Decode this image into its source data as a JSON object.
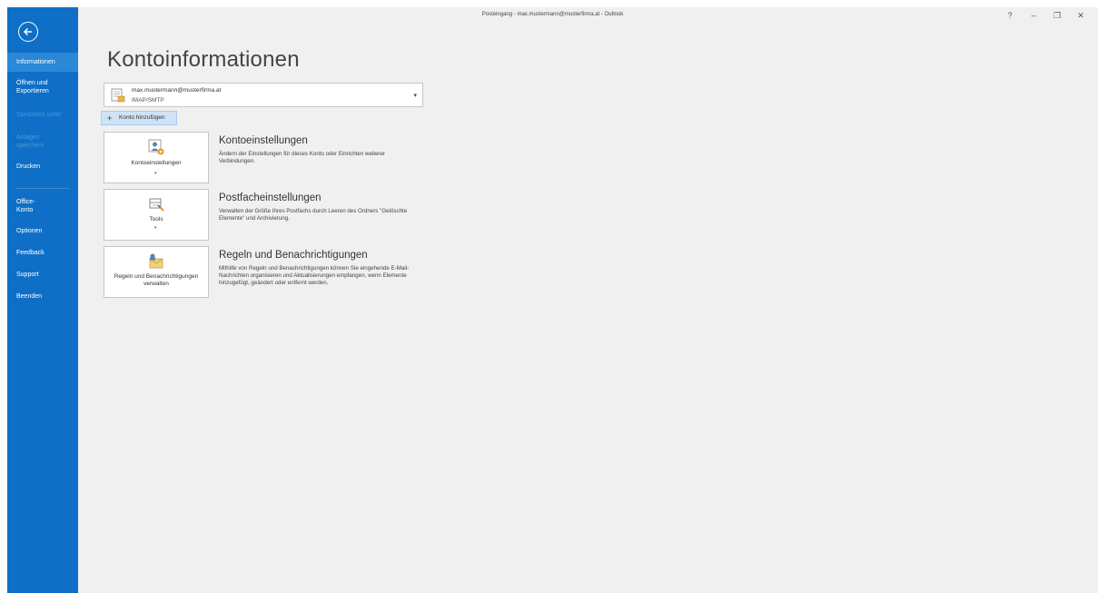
{
  "window": {
    "title": "Posteingang - max.mustermann@musterfirma.at - Outlook",
    "help_label": "?",
    "minimize_label": "–",
    "restore_label": "❐",
    "close_label": "✕"
  },
  "sidebar": {
    "items": [
      {
        "label": "Informationen",
        "state": "active"
      },
      {
        "label": "Öffnen und Exportieren",
        "state": "normal"
      },
      {
        "label": "Speichern unter",
        "state": "disabled"
      },
      {
        "label": "Anlagen speichern",
        "state": "disabled"
      },
      {
        "label": "Drucken",
        "state": "normal"
      },
      {
        "label": "Office-Konto",
        "state": "normal"
      },
      {
        "label": "Optionen",
        "state": "normal"
      },
      {
        "label": "Feedback",
        "state": "normal"
      },
      {
        "label": "Support",
        "state": "normal"
      },
      {
        "label": "Beenden",
        "state": "normal"
      }
    ]
  },
  "main": {
    "title": "Kontoinformationen",
    "account": {
      "email": "max.mustermann@musterfirma.at",
      "type": "IMAP/SMTP"
    },
    "add_account_label": "Konto hinzufügen",
    "sections": [
      {
        "tile_label": "Kontoeinstellungen",
        "tile_icon": "account-settings-icon",
        "title": "Kontoeinstellungen",
        "description": "Ändern der Einstellungen für dieses Konto oder Einrichten weiterer Verbindungen."
      },
      {
        "tile_label": "Tools",
        "tile_icon": "mailbox-tools-icon",
        "title": "Postfacheinstellungen",
        "description": "Verwalten der Größe Ihres Postfachs durch Leeren des Ordners \"Gelöschte Elemente\" und Archivierung."
      },
      {
        "tile_label": "Regeln und Benachrichtigungen verwalten",
        "tile_icon": "rules-alerts-icon",
        "title": "Regeln und Benachrichtigungen",
        "description": "Mithilfe von Regeln und Benachrichtigungen können Sie eingehende E-Mail-Nachrichten organisieren und Aktualisierungen empfangen, wenn Elemente hinzugefügt, geändert oder entfernt werden."
      }
    ]
  },
  "colors": {
    "sidebar_bg": "#0f6fc6",
    "sidebar_active": "#2b88d8",
    "content_bg": "#f0f0f0"
  }
}
